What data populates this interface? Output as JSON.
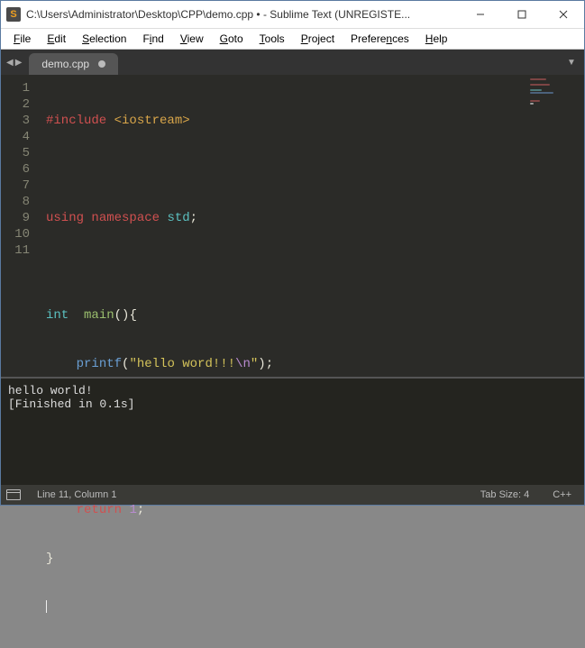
{
  "window": {
    "icon_letter": "S",
    "title": "C:\\Users\\Administrator\\Desktop\\CPP\\demo.cpp • - Sublime Text (UNREGISTE..."
  },
  "menus": {
    "file": {
      "u": "F",
      "rest": "ile"
    },
    "edit": {
      "u": "E",
      "rest": "dit"
    },
    "selection": {
      "u": "S",
      "rest": "election"
    },
    "find": {
      "u": "i",
      "pre": "F",
      "rest": "nd"
    },
    "view": {
      "u": "V",
      "rest": "iew"
    },
    "goto": {
      "u": "G",
      "rest": "oto"
    },
    "tools": {
      "u": "T",
      "rest": "ools"
    },
    "project": {
      "u": "P",
      "rest": "roject"
    },
    "preferences": {
      "u": "n",
      "pre": "Prefere",
      "rest": "ces"
    },
    "help": {
      "u": "H",
      "rest": "elp"
    }
  },
  "tab": {
    "name": "demo.cpp"
  },
  "code": {
    "line1": {
      "a": "#include",
      "b": " ",
      "c": "<iostream>"
    },
    "line3": {
      "a": "using",
      "b": " ",
      "c": "namespace",
      "d": " ",
      "e": "std",
      "f": ";"
    },
    "line5": {
      "a": "int",
      "b": "  ",
      "c": "main",
      "d": "()",
      "e": "{"
    },
    "line6": {
      "indent": "    ",
      "a": "printf",
      "b": "(",
      "c": "\"hello word!!!",
      "d": "\\n",
      "e": "\"",
      "f": ")",
      "g": ";"
    },
    "line9": {
      "indent": "    ",
      "a": "return",
      "b": " ",
      "c": "1",
      "d": ";"
    },
    "line10": {
      "a": "}"
    }
  },
  "line_numbers": [
    "1",
    "2",
    "3",
    "4",
    "5",
    "6",
    "7",
    "8",
    "9",
    "10",
    "11"
  ],
  "console": {
    "l1": "hello world!",
    "l2": "[Finished in 0.1s]"
  },
  "status": {
    "pos": "Line 11, Column 1",
    "tabsize": "Tab Size: 4",
    "lang": "C++"
  }
}
